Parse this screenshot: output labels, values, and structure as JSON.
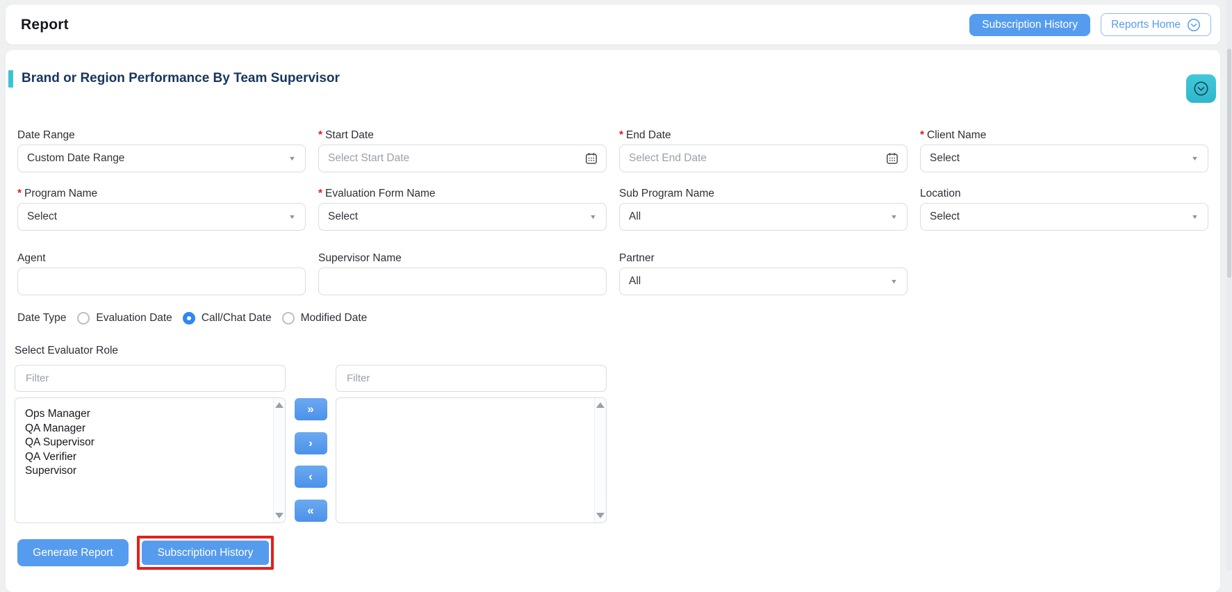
{
  "header": {
    "title": "Report",
    "buttons": {
      "subscription_history": "Subscription History",
      "reports_home": "Reports Home"
    }
  },
  "panel": {
    "title": "Brand or Region Performance By Team Supervisor"
  },
  "form": {
    "required_marker": "*",
    "date_range": {
      "label": "Date Range",
      "required": false,
      "value": "Custom Date Range"
    },
    "start_date": {
      "label": "Start Date",
      "required": true,
      "placeholder": "Select Start Date",
      "value": ""
    },
    "end_date": {
      "label": "End Date",
      "required": true,
      "placeholder": "Select End Date",
      "value": ""
    },
    "client_name": {
      "label": "Client Name",
      "required": true,
      "value": "Select"
    },
    "program_name": {
      "label": "Program Name",
      "required": true,
      "value": "Select"
    },
    "evaluation_form_name": {
      "label": "Evaluation Form Name",
      "required": true,
      "value": "Select"
    },
    "sub_program_name": {
      "label": "Sub Program Name",
      "required": false,
      "value": "All"
    },
    "location": {
      "label": "Location",
      "required": false,
      "value": "Select"
    },
    "agent": {
      "label": "Agent",
      "value": ""
    },
    "supervisor_name": {
      "label": "Supervisor Name",
      "value": ""
    },
    "partner": {
      "label": "Partner",
      "required": false,
      "value": "All"
    }
  },
  "date_type": {
    "label": "Date Type",
    "options": [
      {
        "label": "Evaluation Date",
        "selected": false
      },
      {
        "label": "Call/Chat Date",
        "selected": true
      },
      {
        "label": "Modified Date",
        "selected": false
      }
    ]
  },
  "evaluator_role": {
    "label": "Select Evaluator Role",
    "filter_placeholder": "Filter",
    "available_roles": [
      "Ops Manager",
      "QA Manager",
      "QA Supervisor",
      "QA Verifier",
      "Supervisor"
    ],
    "selected_roles": []
  },
  "actions": {
    "generate_report": "Generate Report",
    "subscription_history": "Subscription History"
  },
  "icons": {
    "calendar": "calendar-icon",
    "caret_down": "caret-down-icon",
    "chevron_down_circle": "chevron-down-circle-icon",
    "move_all_right": "»",
    "move_right": "›",
    "move_left": "‹",
    "move_all_left": "«"
  },
  "colors": {
    "primary_blue": "#569CEE",
    "teal_accent": "#3CC3D5",
    "title_navy": "#17365D",
    "required_red": "#E02020",
    "highlight_red": "#E2201D",
    "radio_selected_blue": "#2F86F6",
    "page_background": "#EEF0F2"
  }
}
